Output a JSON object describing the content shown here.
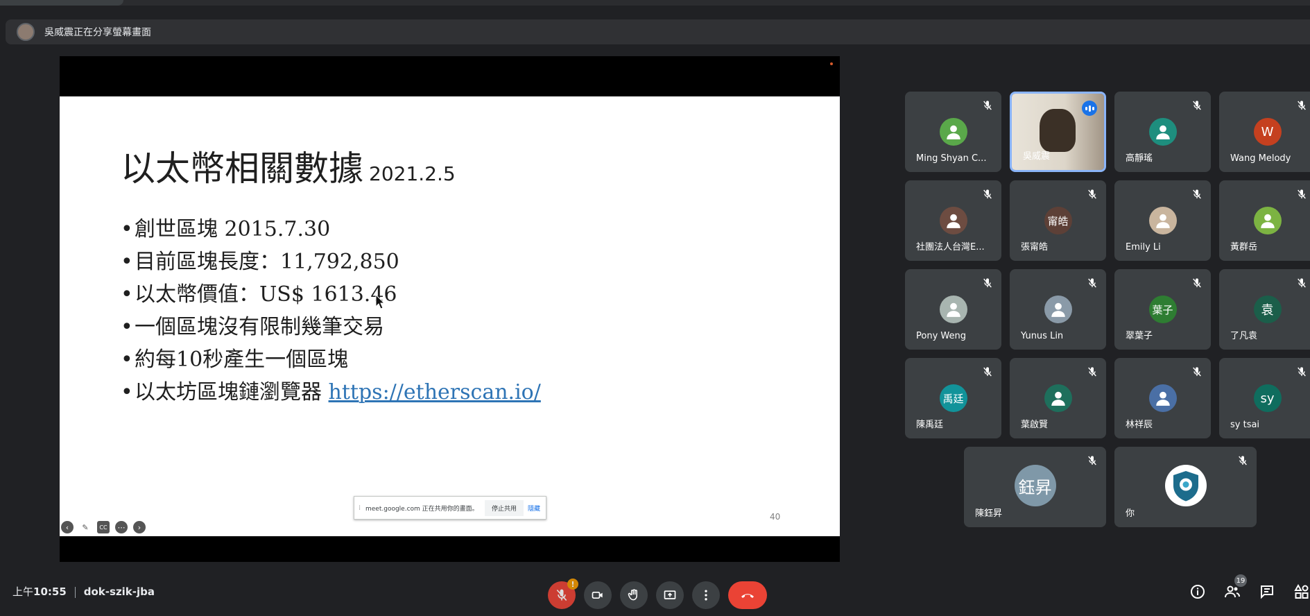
{
  "presenter": {
    "banner": "吳威震正在分享螢幕畫面"
  },
  "slide": {
    "title": "以太幣相關數據",
    "date": "2021.2.5",
    "bullets": [
      "創世區塊 2015.7.30",
      "目前區塊長度：11,792,850",
      "以太幣價值：US$ 1613.46",
      "一個區塊沒有限制幾筆交易",
      "約每10秒產生一個區塊",
      "以太坊區塊鏈瀏覽器 "
    ],
    "link": "https://etherscan.io/",
    "page_number": "40",
    "tools": {
      "cc": "CC"
    }
  },
  "share_toast": {
    "text": "meet.google.com 正在共用你的畫面。",
    "stop_label": "停止共用",
    "hide_label": "隱藏"
  },
  "participants": [
    {
      "name": "Ming Shyan C...",
      "avatar_text": "",
      "avatar_color": "#5aa84a"
    },
    {
      "name": "吳威震",
      "avatar_text": "",
      "avatar_color": "#7b6f64",
      "speaking": true
    },
    {
      "name": "高靜瑤",
      "avatar_text": "",
      "avatar_color": "#1e8e7e"
    },
    {
      "name": "Wang Melody",
      "avatar_text": "W",
      "avatar_color": "#c5401f"
    },
    {
      "name": "社團法人台灣E...",
      "avatar_text": "",
      "avatar_color": "#6d4c41"
    },
    {
      "name": "張甯皓",
      "avatar_text": "甯皓",
      "avatar_color": "#5d4037"
    },
    {
      "name": "Emily Li",
      "avatar_text": "",
      "avatar_color": "#c9b59e"
    },
    {
      "name": "黃群岳",
      "avatar_text": "",
      "avatar_color": "#7cb342"
    },
    {
      "name": "Pony Weng",
      "avatar_text": "",
      "avatar_color": "#a8b5b0"
    },
    {
      "name": "Yunus Lin",
      "avatar_text": "",
      "avatar_color": "#8a9aa8"
    },
    {
      "name": "翠葉子",
      "avatar_text": "葉子",
      "avatar_color": "#2e7d32"
    },
    {
      "name": "了凡袁",
      "avatar_text": "袁",
      "avatar_color": "#1b5e4a"
    },
    {
      "name": "陳禹廷",
      "avatar_text": "禹廷",
      "avatar_color": "#12939a"
    },
    {
      "name": "葉啟賢",
      "avatar_text": "",
      "avatar_color": "#1e6f5c"
    },
    {
      "name": "林祥辰",
      "avatar_text": "",
      "avatar_color": "#4a6fa5"
    },
    {
      "name": "sy tsai",
      "avatar_text": "sy",
      "avatar_color": "#0f6d5e"
    },
    {
      "name": "陳鈺昇",
      "avatar_text": "鈺昇",
      "avatar_color": "#7f98a8"
    },
    {
      "name": "你",
      "avatar_text": "",
      "avatar_color": "#ffffff"
    }
  ],
  "bottom": {
    "time_prefix": "上午",
    "time": "10:55",
    "meeting_code": "dok-szik-jba",
    "mic_warning": "!",
    "participant_count": "19"
  },
  "colors": {
    "end_call": "#ea4335",
    "speaking_border": "#8ab4f8",
    "link": "#2e74b5"
  }
}
